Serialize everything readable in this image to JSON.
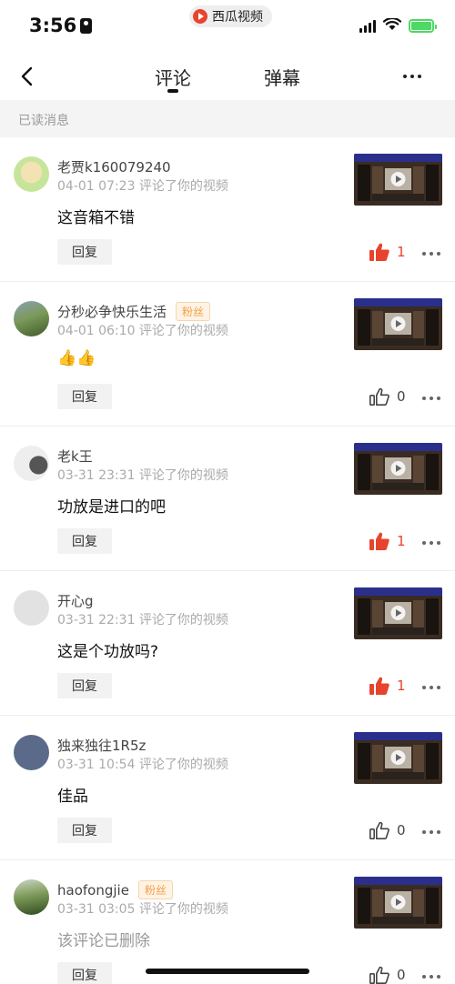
{
  "status": {
    "time": "3:56",
    "app_name": "西瓜视频"
  },
  "nav": {
    "tab_comments": "评论",
    "tab_danmaku": "弹幕"
  },
  "section": {
    "title": "已读消息"
  },
  "colors": {
    "accent": "#e8432d",
    "fan_badge": "#f2a04a"
  },
  "items": [
    {
      "user": "老贾k160079240",
      "fan": "",
      "time": "04-01 07:23 评论了你的视频",
      "comment": "这音箱不错",
      "reply": "回复",
      "likes": "1",
      "liked": true
    },
    {
      "user": "分秒必争快乐生活",
      "fan": "粉丝",
      "time": "04-01 06:10 评论了你的视频",
      "comment": "👍👍",
      "reply": "回复",
      "likes": "0",
      "liked": false
    },
    {
      "user": "老k王",
      "fan": "",
      "time": "03-31 23:31 评论了你的视频",
      "comment": "功放是进口的吧",
      "reply": "回复",
      "likes": "1",
      "liked": true
    },
    {
      "user": "开心g",
      "fan": "",
      "time": "03-31 22:31 评论了你的视频",
      "comment": "这是个功放吗?",
      "reply": "回复",
      "likes": "1",
      "liked": true
    },
    {
      "user": "独来独往1R5z",
      "fan": "",
      "time": "03-31 10:54 评论了你的视频",
      "comment": "佳品",
      "reply": "回复",
      "likes": "0",
      "liked": false
    },
    {
      "user": "haofongjie",
      "fan": "粉丝",
      "time": "03-31 03:05 评论了你的视频",
      "comment": "该评论已删除",
      "reply": "回复",
      "likes": "0",
      "liked": false
    }
  ]
}
